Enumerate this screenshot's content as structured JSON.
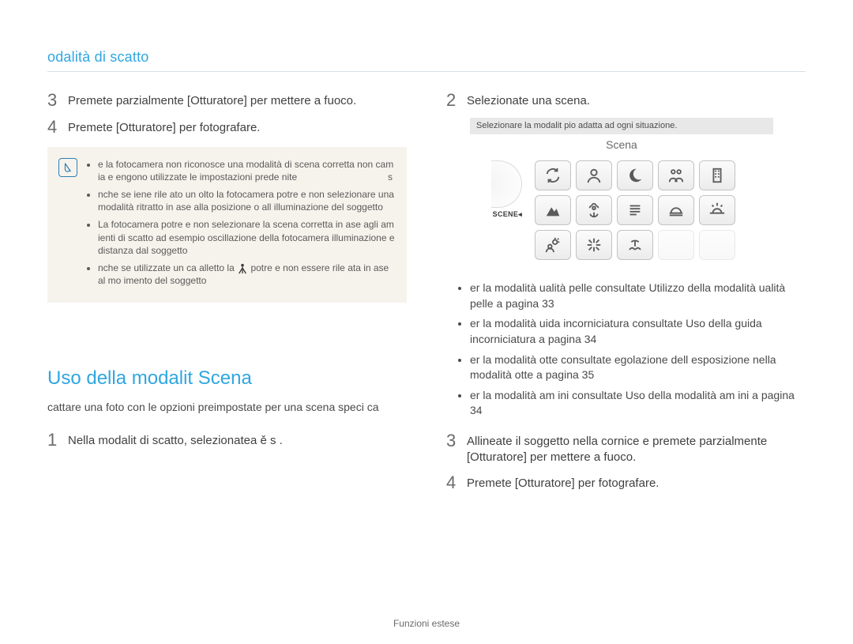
{
  "header": {
    "breadcrumb": "odalità di scatto"
  },
  "left": {
    "steps": [
      {
        "num": "3",
        "text": "Premete parzialmente [Otturatore] per mettere a fuoco."
      },
      {
        "num": "4",
        "text": "Premete [Otturatore] per fotografare."
      }
    ],
    "note_letter": "s",
    "note_items": [
      "e la fotocamera non riconosce una modalità di scena corretta          non cam ia e  engono utilizzate le impostazioni prede nite",
      "nche se  iene rile ato un  olto  la fotocamera potre  e non selezionare una modalità ritratto in  ase alla posizione o all illuminazione del soggetto",
      "La fotocamera potre  e non selezionare la scena corretta in  ase agli am ienti di scatto  ad esempio oscillazione della fotocamera  illuminazione e distanza dal soggetto",
      "nche se utilizzate un ca alletto  la        potre  e non essere rile ata in  ase al mo imento del soggetto"
    ],
    "tripod_icon": "tripod-icon",
    "section_title": "Uso della modalit   Scena",
    "section_desc": "cattare una foto con le opzioni preimpostate per una scena speci ca",
    "step1": {
      "num": "1",
      "text": "Nella modalit   di scatto, selezionatea    ě   s       ."
    }
  },
  "right": {
    "step2": {
      "num": "2",
      "text": "Selezionate una scena."
    },
    "lcd": {
      "hint": "Selezionare la modalit   pio adatta ad ogni situazione.",
      "title": "Scena",
      "scene_label": "SCENE",
      "icons": [
        "refresh-arrows-icon",
        "portrait-icon",
        "moon-icon",
        "children-icon",
        "building-icon",
        "landscape-icon",
        "macro-flower-icon",
        "text-lines-icon",
        "sunset-icon",
        "dawn-rays-icon",
        "backlight-icon",
        "fireworks-icon",
        "beach-icon",
        "ghost1",
        "ghost2"
      ]
    },
    "bullets": [
      "er la modalità      ualità pelle  consultate  Utilizzo della modalità  ualità pelle  a pagina 33",
      "er la modalità      uida incorniciatura  consultate  Uso della guida incorniciatura  a pagina 34",
      "er la modalità      otte  consultate  egolazione dell esposizione nella modalità  otte  a pagina 35",
      "er la modalità      am ini  consultate  Uso della modalità  am ini  a pagina 34"
    ],
    "step3": {
      "num": "3",
      "text": "Allineate il soggetto nella cornice e premete parzialmente [Otturatore] per mettere a fuoco."
    },
    "step4": {
      "num": "4",
      "text": "Premete [Otturatore] per fotografare."
    }
  },
  "footer": {
    "text": "Funzioni estese"
  }
}
